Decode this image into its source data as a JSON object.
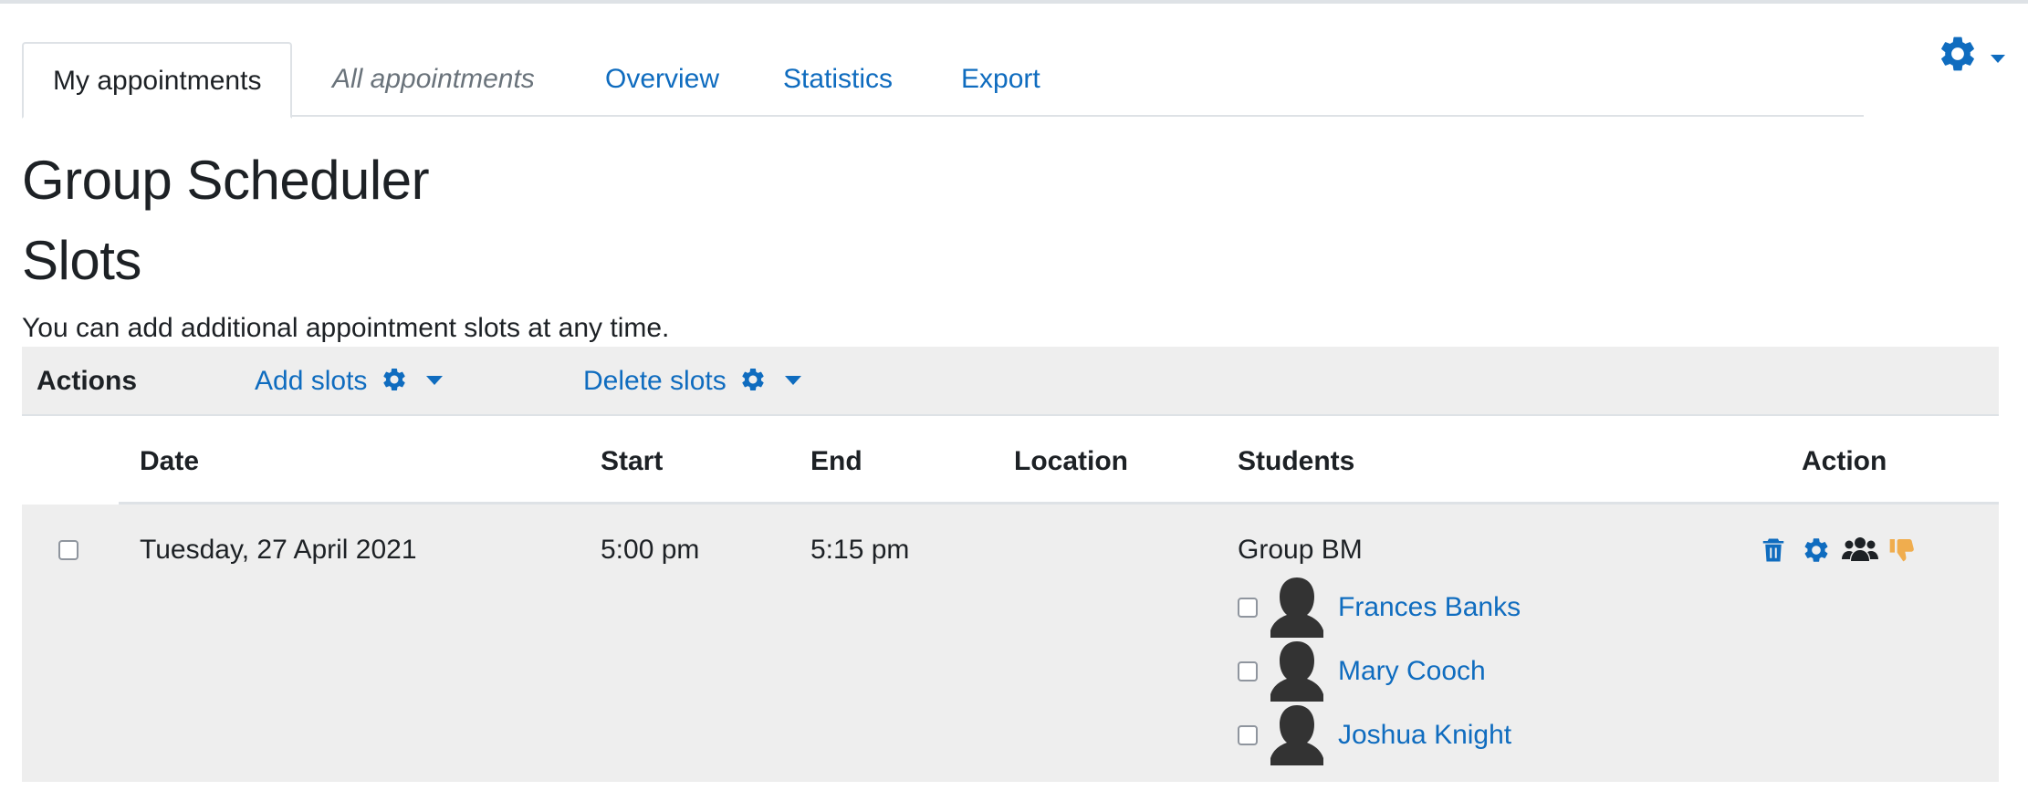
{
  "tabs": [
    {
      "label": "My appointments",
      "active": true
    },
    {
      "label": "All appointments",
      "italic": true
    },
    {
      "label": "Overview"
    },
    {
      "label": "Statistics"
    },
    {
      "label": "Export"
    }
  ],
  "page": {
    "title": "Group Scheduler",
    "subtitle": "Slots",
    "intro": "You can add additional appointment slots at any time."
  },
  "actions_bar": {
    "label": "Actions",
    "add_slots": "Add slots",
    "delete_slots": "Delete slots"
  },
  "table": {
    "headers": {
      "date": "Date",
      "start": "Start",
      "end": "End",
      "location": "Location",
      "students": "Students",
      "action": "Action"
    },
    "rows": [
      {
        "date": "Tuesday, 27 April 2021",
        "start": "5:00 pm",
        "end": "5:15 pm",
        "location": "",
        "group": "Group BM",
        "students": [
          "Frances Banks",
          "Mary Cooch",
          "Joshua Knight"
        ],
        "actions": [
          "trash-icon",
          "gear-icon",
          "users-icon",
          "thumbs-down-icon"
        ]
      }
    ]
  },
  "colors": {
    "link": "#0f6cbf",
    "text": "#1d2125",
    "muted": "#6a737b",
    "bar_bg": "#eeeeee",
    "border": "#dee2e6",
    "thumb": "#f0ad4e"
  }
}
